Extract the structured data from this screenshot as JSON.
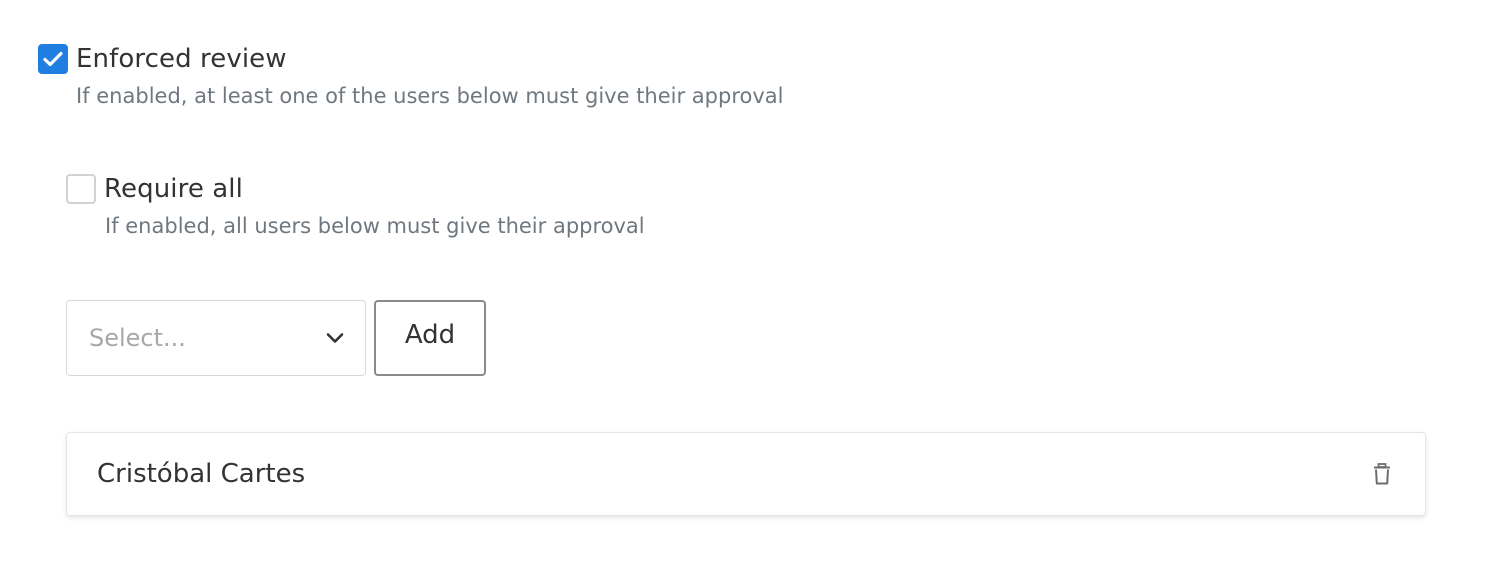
{
  "enforced_review": {
    "label": "Enforced review",
    "checked": true,
    "help": "If enabled, at least one of the users below must give their approval"
  },
  "require_all": {
    "label": "Require all",
    "checked": false,
    "help": "If enabled, all users below must give their approval"
  },
  "user_select": {
    "placeholder": "Select...",
    "icon": "chevron-down-icon"
  },
  "add_button": {
    "label": "Add"
  },
  "users": [
    {
      "name": "Cristóbal Cartes",
      "action_icon": "trash-icon"
    }
  ],
  "colors": {
    "accent": "#1f7fe0",
    "help_text": "#6f777f",
    "border": "#d9d9d9"
  }
}
